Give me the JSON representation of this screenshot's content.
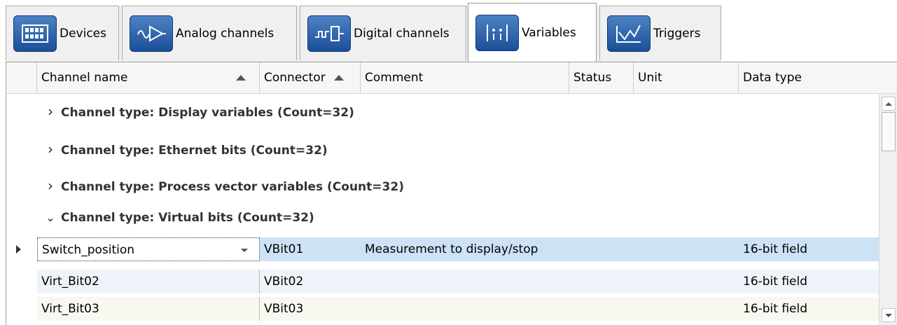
{
  "tabs": [
    {
      "label": "Devices",
      "icon": "devices-icon"
    },
    {
      "label": "Analog channels",
      "icon": "analog-channel-icon"
    },
    {
      "label": "Digital channels",
      "icon": "digital-channel-icon"
    },
    {
      "label": "Variables",
      "icon": "variables-icon",
      "active": true
    },
    {
      "label": "Triggers",
      "icon": "triggers-icon"
    }
  ],
  "columns": {
    "channel_name": "Channel name",
    "connector": "Connector",
    "comment": "Comment",
    "status": "Status",
    "unit": "Unit",
    "data_type": "Data type"
  },
  "groups": [
    {
      "label": "Channel type: Display variables (Count=32)",
      "expanded": false
    },
    {
      "label": "Channel type: Ethernet bits (Count=32)",
      "expanded": false
    },
    {
      "label": "Channel type: Process vector variables (Count=32)",
      "expanded": false
    },
    {
      "label": "Channel type: Virtual bits (Count=32)",
      "expanded": true
    }
  ],
  "rows": [
    {
      "name": "Switch_position",
      "connector": "VBit01",
      "comment": "Measurement to display/stop",
      "data_type": "16-bit field",
      "selected": true
    },
    {
      "name": "Virt_Bit02",
      "connector": "VBit02",
      "comment": "",
      "data_type": "16-bit field"
    },
    {
      "name": "Virt_Bit03",
      "connector": "VBit03",
      "comment": "",
      "data_type": "16-bit field"
    }
  ],
  "colors": {
    "selected_row": "#cde3f5",
    "alt_row": "#eef3fa",
    "row3": "#f8f8f0",
    "tab_icon": "#2a5ea8"
  }
}
